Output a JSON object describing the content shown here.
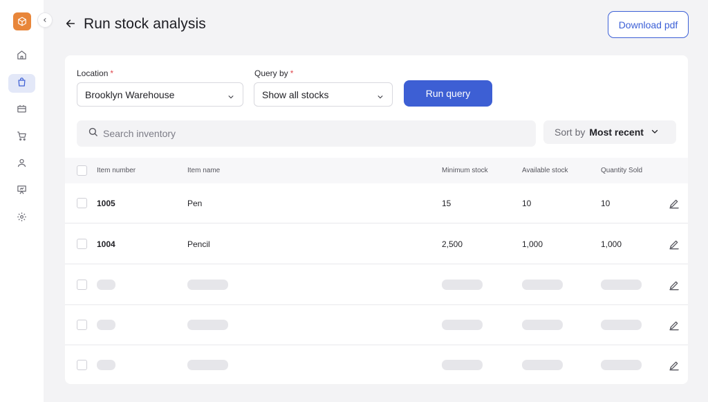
{
  "colors": {
    "accent": "#3d5fd4",
    "brand": "#e8863a",
    "required": "#e0484e"
  },
  "sidebar": {
    "logo_icon": "box-icon",
    "collapse_icon": "chevron-left-icon",
    "items": [
      {
        "icon": "home-icon",
        "active": false
      },
      {
        "icon": "shopping-bag-icon",
        "active": true
      },
      {
        "icon": "ticket-icon",
        "active": false
      },
      {
        "icon": "cart-icon",
        "active": false
      },
      {
        "icon": "user-icon",
        "active": false
      },
      {
        "icon": "presentation-icon",
        "active": false
      },
      {
        "icon": "gear-icon",
        "active": false
      }
    ]
  },
  "header": {
    "title": "Run stock analysis",
    "download_label": "Download pdf"
  },
  "form": {
    "location_label": "Location",
    "location_value": "Brooklyn Warehouse",
    "query_label": "Query by",
    "query_value": "Show all stocks",
    "required_mark": "*",
    "run_label": "Run query"
  },
  "search": {
    "placeholder": "Search inventory"
  },
  "sort": {
    "label": "Sort by",
    "value": "Most recent"
  },
  "table": {
    "columns": [
      "Item number",
      "Item name",
      "Minimum stock",
      "Available stock",
      "Quantity Sold"
    ],
    "rows": [
      {
        "item_number": "1005",
        "item_name": "Pen",
        "minimum_stock": "15",
        "available_stock": "10",
        "quantity_sold": "10"
      },
      {
        "item_number": "1004",
        "item_name": "Pencil",
        "minimum_stock": "2,500",
        "available_stock": "1,000",
        "quantity_sold": "1,000"
      }
    ],
    "placeholder_rows": 3
  }
}
